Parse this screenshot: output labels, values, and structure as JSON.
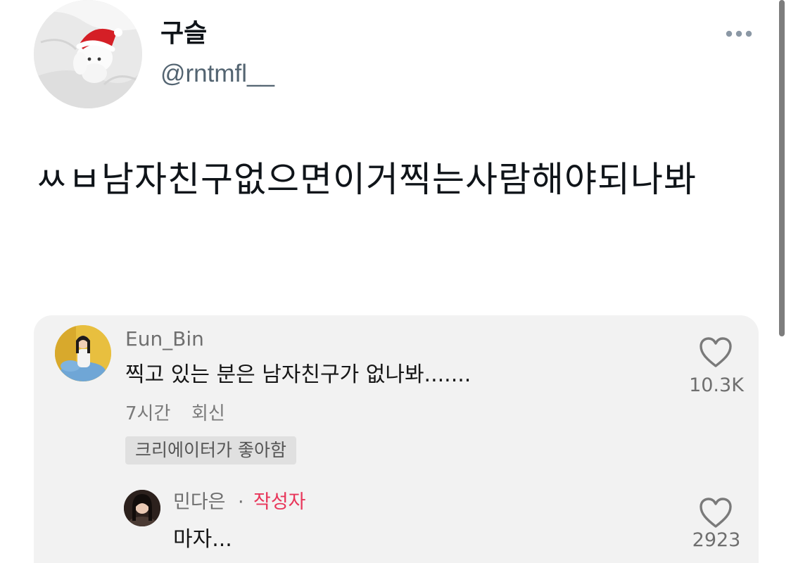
{
  "tweet": {
    "display_name": "구슬",
    "handle": "@rntmfl__",
    "text": "ㅆㅂ남자친구없으면이거찍는사람해야되나봐",
    "more_icon": "more-horizontal-icon"
  },
  "comment": {
    "username": "Eun_Bin",
    "text": "찍고 있는 분은 남자친구가 없나봐.......",
    "time": "7시간",
    "reply_label": "회신",
    "creator_liked_badge": "크리에이터가 좋아함",
    "like_count": "10.3K",
    "like_icon": "heart-icon"
  },
  "reply": {
    "username": "민다은",
    "separator": "·",
    "author_label": "작성자",
    "text": "마자...",
    "like_count": "2923",
    "like_icon": "heart-icon"
  },
  "colors": {
    "author_label": "#e8365a",
    "card_background": "#f2f2f2",
    "handle": "#536471"
  }
}
